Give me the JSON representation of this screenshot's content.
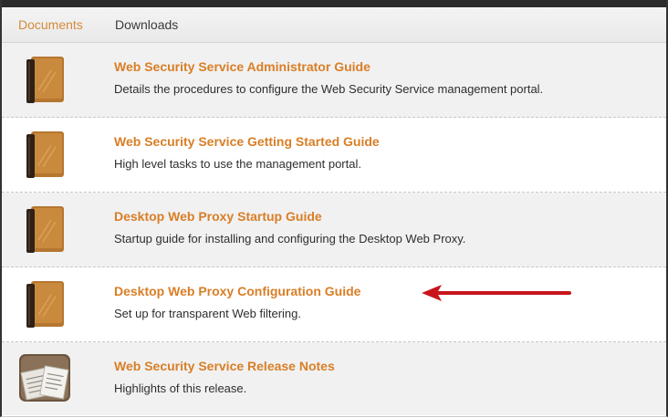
{
  "tabs": {
    "documents_label": "Documents",
    "downloads_label": "Downloads"
  },
  "documents": [
    {
      "title": "Web Security Service Administrator Guide",
      "description": "Details the procedures to configure the Web Security Service management portal.",
      "icon": "book-icon"
    },
    {
      "title": "Web Security Service Getting Started Guide",
      "description": "High level tasks to use the management portal.",
      "icon": "book-icon"
    },
    {
      "title": "Desktop Web Proxy Startup Guide",
      "description": "Startup guide for installing and configuring the Desktop Web Proxy.",
      "icon": "book-icon"
    },
    {
      "title": "Desktop Web Proxy Configuration Guide",
      "description": "Set up for transparent Web filtering.",
      "icon": "book-icon"
    },
    {
      "title": "Web Security Service Release Notes",
      "description": "Highlights of this release.",
      "icon": "release-notes-icon"
    }
  ],
  "annotation": {
    "icon": "red-arrow-icon",
    "color": "#c8151b"
  },
  "colors": {
    "link": "#d97e26",
    "active_tab": "#d58a3a",
    "alt_row": "#f1f1f1"
  }
}
